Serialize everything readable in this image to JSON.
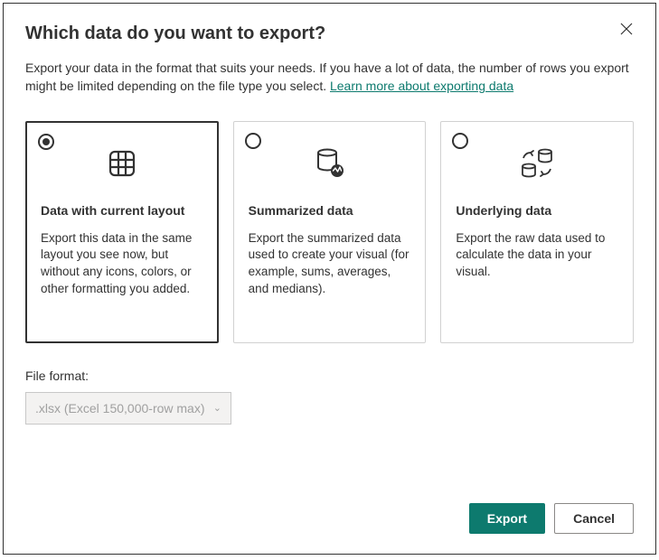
{
  "title": "Which data do you want to export?",
  "description_part1": "Export your data in the format that suits your needs. If you have a lot of data, the number of rows you export might be limited depending on the file type you select.  ",
  "link_text": "Learn more about exporting data",
  "options": [
    {
      "title": "Data with current layout",
      "desc": "Export this data in the same layout you see now, but without any icons, colors, or other formatting you added."
    },
    {
      "title": "Summarized data",
      "desc": "Export the summarized data used to create your visual (for example, sums, averages, and medians)."
    },
    {
      "title": "Underlying data",
      "desc": "Export the raw data used to calculate the data in your visual."
    }
  ],
  "file_format_label": "File format:",
  "file_format_value": ".xlsx (Excel 150,000-row max)",
  "buttons": {
    "export": "Export",
    "cancel": "Cancel"
  }
}
